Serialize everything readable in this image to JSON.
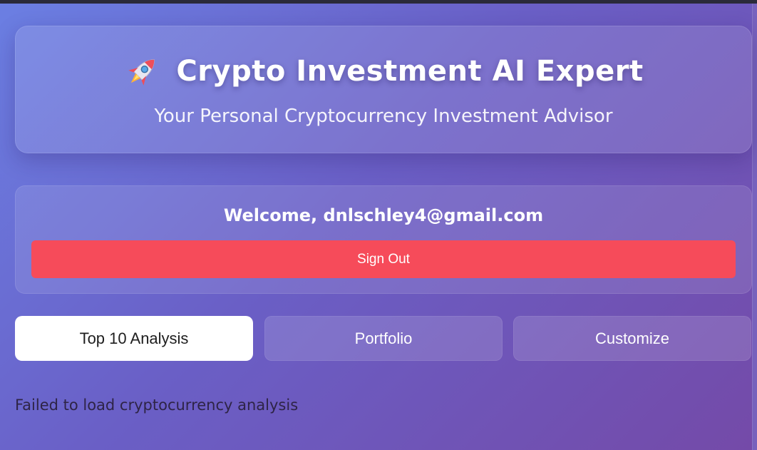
{
  "header": {
    "title": "Crypto Investment AI Expert",
    "subtitle": "Your Personal Cryptocurrency Investment Advisor",
    "icon": "rocket-icon"
  },
  "account": {
    "welcome": "Welcome, dnlschley4@gmail.com",
    "sign_out_label": "Sign Out",
    "sign_out_color": "#f64b5a"
  },
  "tabs": [
    {
      "label": "Top 10 Analysis",
      "active": true
    },
    {
      "label": "Portfolio",
      "active": false
    },
    {
      "label": "Customize",
      "active": false
    }
  ],
  "status": {
    "message": "Failed to load cryptocurrency analysis"
  }
}
